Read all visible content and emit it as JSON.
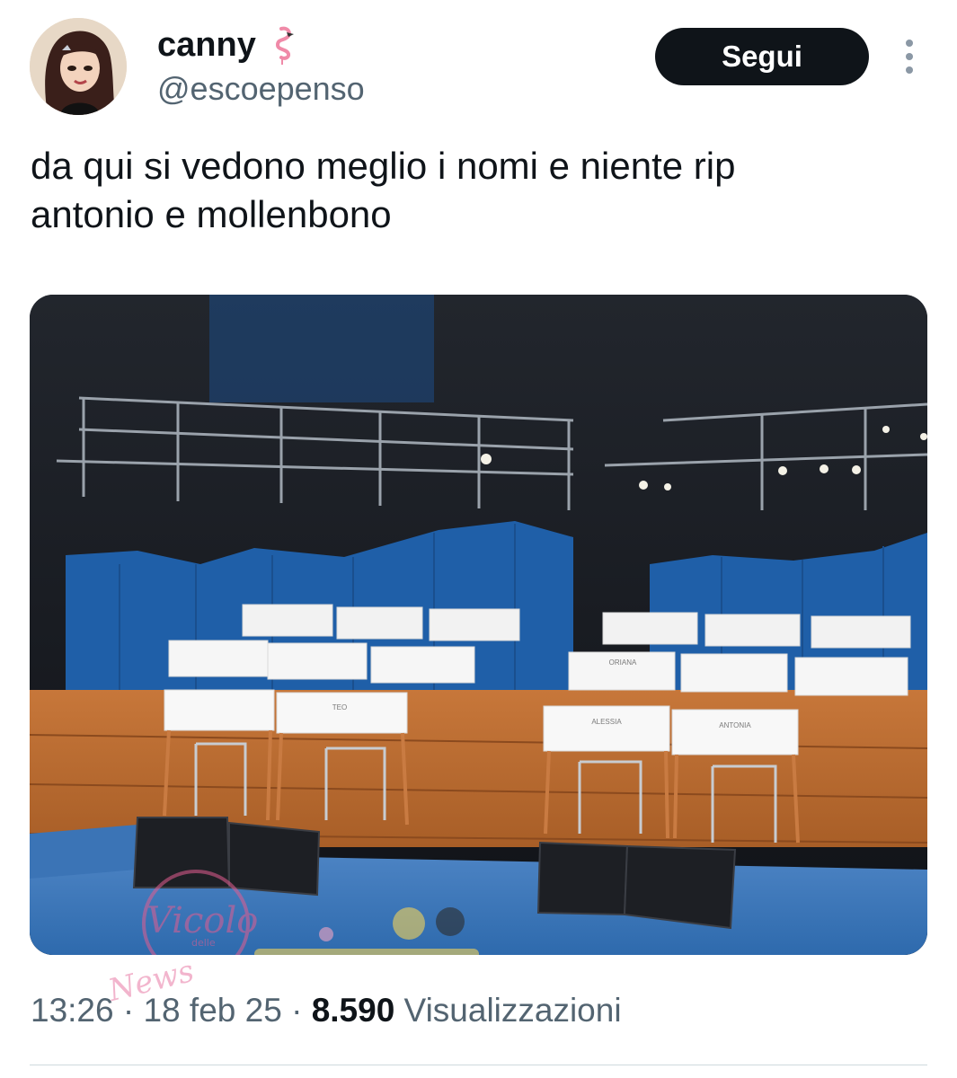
{
  "author": {
    "display_name": "canny",
    "name_emoji_icon": "flamingo-icon",
    "handle": "@escoepenso"
  },
  "actions": {
    "follow_label": "Segui",
    "more_icon": "more-vertical-icon"
  },
  "tweet": {
    "text": "da qui si vedono meglio i nomi e niente rip\nantonio e mollenbono"
  },
  "media": {
    "desk_labels": [
      "ALESSIA",
      "ANTONIA",
      "ORIANA",
      "TEO"
    ]
  },
  "meta": {
    "time": "13:26",
    "sep1": " · ",
    "date": "18 feb 25",
    "sep2": " · ",
    "views": "8.590",
    "views_label": " Visualizzazioni"
  },
  "watermark": {
    "line1": "Vicolo",
    "line2": "delle",
    "line3": "News"
  },
  "colors": {
    "follow_bg": "#0f1419",
    "meta_gray": "#536471",
    "stage_blue": "#1f5fa8",
    "stage_wood": "#b9692f"
  }
}
